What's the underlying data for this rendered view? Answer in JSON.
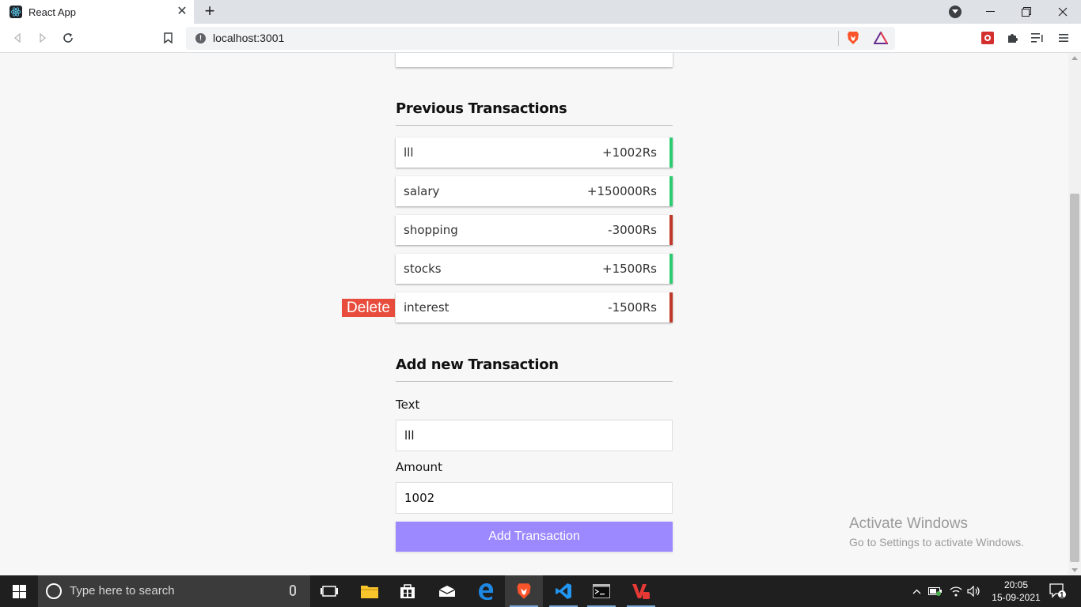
{
  "browser": {
    "tab_title": "React App",
    "tab_close": "✕",
    "new_tab": "+",
    "url": "localhost:3001"
  },
  "page": {
    "history_title": "Previous Transactions",
    "transactions": [
      {
        "text": "lll",
        "amount": "+1002Rs",
        "type": "plus"
      },
      {
        "text": "salary",
        "amount": "+150000Rs",
        "type": "plus"
      },
      {
        "text": "shopping",
        "amount": "-3000Rs",
        "type": "minus"
      },
      {
        "text": "stocks",
        "amount": "+1500Rs",
        "type": "plus"
      },
      {
        "text": "interest",
        "amount": "-1500Rs",
        "type": "minus"
      }
    ],
    "delete_label": "Delete",
    "add_title": "Add new Transaction",
    "text_label": "Text",
    "text_value": "lll",
    "amount_label": "Amount",
    "amount_value": "1002",
    "add_button": "Add Transaction"
  },
  "watermark": {
    "line1": "Activate Windows",
    "line2": "Go to Settings to activate Windows."
  },
  "taskbar": {
    "search_placeholder": "Type here to search",
    "time": "20:05",
    "date": "15-09-2021",
    "notifications": "1"
  },
  "colors": {
    "plus": "#2ecc71",
    "minus": "#c0392b",
    "accent": "#9c88ff",
    "delete": "#e74c3c"
  }
}
